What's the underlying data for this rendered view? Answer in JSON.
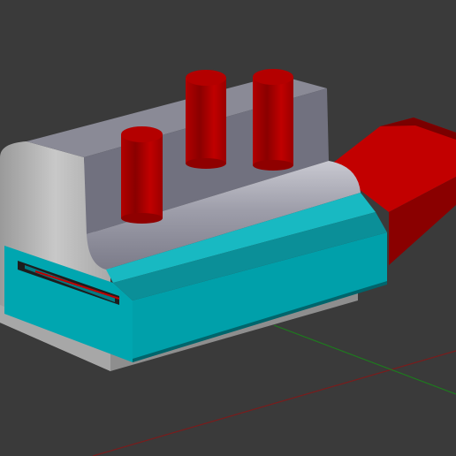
{
  "viewport": {
    "background": "#3a3a3a",
    "axes": {
      "x_axis_color": "#8a1f1f",
      "y_axis_color": "#1f8a1f"
    }
  },
  "model": {
    "colors": {
      "body_top": "#8d8d97",
      "body_front": "#707080",
      "body_side_light": "#bdbdbd",
      "body_side_mid": "#a9a9a9",
      "cyan_face": "#00a3ad",
      "cyan_top": "#12b7c0",
      "cyan_dark": "#006b73",
      "red_light": "#cc0000",
      "red_mid": "#a50000",
      "red_dark": "#6e0000",
      "cylinder_top": "#b00000",
      "slot": "#1a1a1a"
    }
  }
}
